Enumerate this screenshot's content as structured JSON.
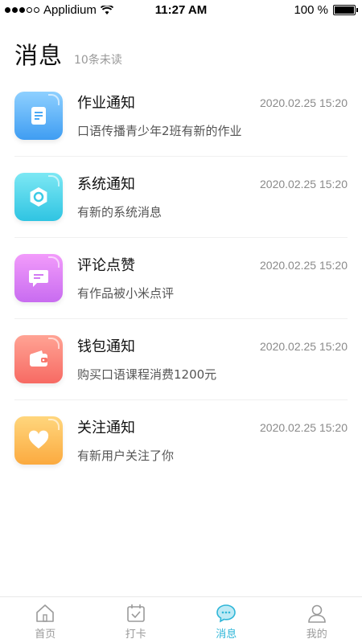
{
  "status_bar": {
    "carrier": "Applidium",
    "time": "11:27 AM",
    "battery": "100 %",
    "signal_filled": 3,
    "signal_total": 5
  },
  "header": {
    "title": "消息",
    "unread": "10条未读"
  },
  "messages": [
    {
      "title": "作业通知",
      "time": "2020.02.25 15:20",
      "desc": "口语传播青少年2班有新的作业",
      "icon": "document-icon",
      "color": "#4aa8f5"
    },
    {
      "title": "系统通知",
      "time": "2020.02.25 15:20",
      "desc": "有新的系统消息",
      "icon": "hexagon-icon",
      "color": "#3ccbe6"
    },
    {
      "title": "评论点赞",
      "time": "2020.02.25 15:20",
      "desc": "有作品被小米点评",
      "icon": "chat-bubble-icon",
      "color": "#d27af3"
    },
    {
      "title": "钱包通知",
      "time": "2020.02.25 15:20",
      "desc": "购买口语课程消费1200元",
      "icon": "wallet-icon",
      "color": "#f8756b"
    },
    {
      "title": "关注通知",
      "time": "2020.02.25 15:20",
      "desc": "有新用户关注了你",
      "icon": "heart-icon",
      "color": "#fcb64b"
    }
  ],
  "tabs": [
    {
      "label": "首页",
      "icon": "home-icon",
      "active": false
    },
    {
      "label": "打卡",
      "icon": "calendar-check-icon",
      "active": false
    },
    {
      "label": "消息",
      "icon": "message-icon",
      "active": true
    },
    {
      "label": "我的",
      "icon": "user-icon",
      "active": false
    }
  ],
  "colors": {
    "accent": "#2fb6d8",
    "inactive": "#9a9a9a"
  }
}
